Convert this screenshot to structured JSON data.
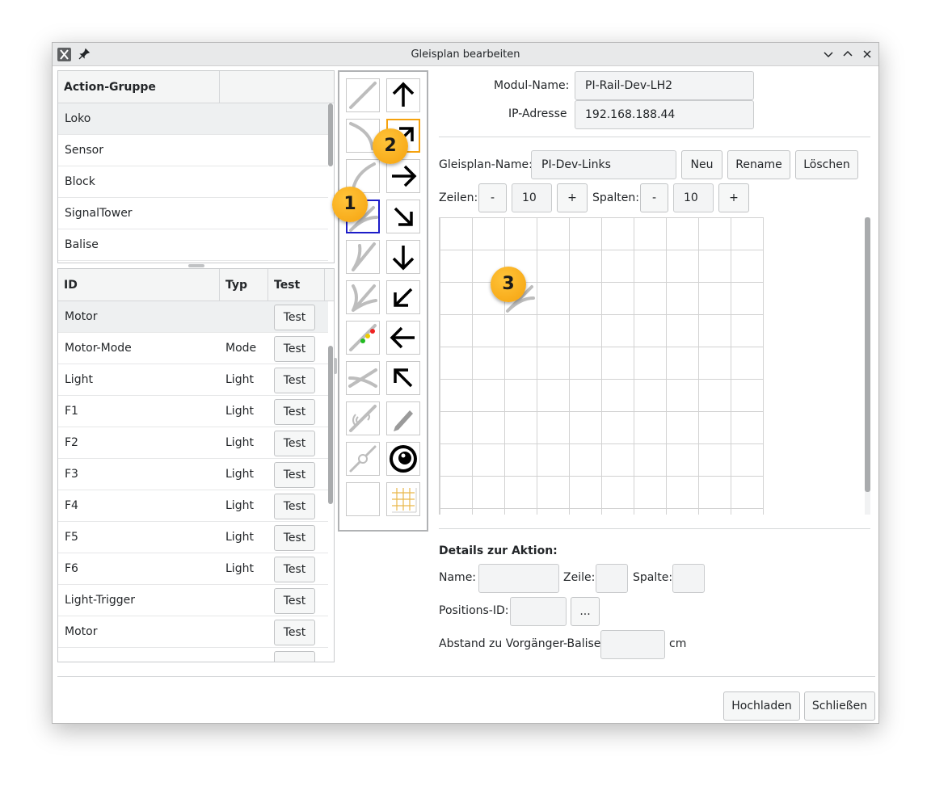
{
  "window": {
    "title": "Gleisplan bearbeiten"
  },
  "action_groups": {
    "header": "Action-Gruppe",
    "items": [
      "Loko",
      "Sensor",
      "Block",
      "SignalTower",
      "Balise"
    ]
  },
  "actions": {
    "headers": {
      "id": "ID",
      "typ": "Typ",
      "test": "Test"
    },
    "rows": [
      {
        "id": "Motor",
        "typ": "",
        "test": "Test"
      },
      {
        "id": "Motor-Mode",
        "typ": "Mode",
        "test": "Test"
      },
      {
        "id": "Light",
        "typ": "Light",
        "test": "Test"
      },
      {
        "id": "F1",
        "typ": "Light",
        "test": "Test"
      },
      {
        "id": "F2",
        "typ": "Light",
        "test": "Test"
      },
      {
        "id": "F3",
        "typ": "Light",
        "test": "Test"
      },
      {
        "id": "F4",
        "typ": "Light",
        "test": "Test"
      },
      {
        "id": "F5",
        "typ": "Light",
        "test": "Test"
      },
      {
        "id": "F6",
        "typ": "Light",
        "test": "Test"
      },
      {
        "id": "Light-Trigger",
        "typ": "",
        "test": "Test"
      },
      {
        "id": "Motor",
        "typ": "",
        "test": "Test"
      }
    ]
  },
  "module": {
    "name_label": "Modul-Name:",
    "name_value": "PI-Rail-Dev-LH2",
    "ip_label": "IP-Adresse",
    "ip_value": "192.168.188.44"
  },
  "plan": {
    "name_label": "Gleisplan-Name:",
    "name_value": "PI-Dev-Links",
    "new_button": "Neu",
    "rename_button": "Rename",
    "delete_button": "Löschen",
    "rows_label": "Zeilen:",
    "rows_value": "10",
    "cols_label": "Spalten:",
    "cols_value": "10",
    "minus": "-",
    "plus": "+"
  },
  "details": {
    "heading": "Details zur Aktion:",
    "name_label": "Name:",
    "row_label": "Zeile:",
    "col_label": "Spalte:",
    "pos_label": "Positions-ID:",
    "pos_button": "...",
    "distance_label": "Abstand zu Vorgänger-Balise:",
    "distance_unit": "cm"
  },
  "footer": {
    "upload_button": "Hochladen",
    "close_button": "Schließen"
  },
  "badges": [
    "1",
    "2",
    "3"
  ],
  "colors": {
    "selection_blue": "#1c1cc8",
    "highlight_orange": "#f5a20e"
  }
}
